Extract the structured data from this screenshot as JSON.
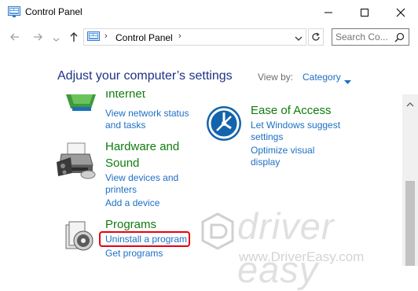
{
  "window": {
    "title": "Control Panel",
    "icon": "control-panel-icon",
    "controls": [
      "minimize",
      "maximize",
      "close"
    ]
  },
  "navigation": {
    "back_icon": "back-arrow-icon",
    "forward_icon": "forward-arrow-icon",
    "recent_icon": "chevron-down-icon",
    "up_icon": "up-arrow-icon",
    "breadcrumb": "Control Panel",
    "refresh_icon": "refresh-icon",
    "search_placeholder": "Search Co..."
  },
  "main": {
    "heading": "Adjust your computer’s settings",
    "view_by_label": "View by:",
    "view_by_value": "Category"
  },
  "categories": {
    "internet": {
      "title": "Internet",
      "links": [
        "View network status",
        "and tasks"
      ]
    },
    "hardware": {
      "title_line1": "Hardware and",
      "title_line2": "Sound",
      "links": [
        "View devices and",
        "printers",
        "Add a device"
      ]
    },
    "programs": {
      "title": "Programs",
      "links": [
        "Uninstall a program",
        "Get programs"
      ]
    },
    "ease": {
      "title": "Ease of Access",
      "links": [
        "Let Windows suggest",
        "settings",
        "Optimize visual",
        "display"
      ]
    }
  },
  "watermark": {
    "brand": "driver easy",
    "url": "www.DriverEasy.com"
  },
  "colors": {
    "heading": "#1e3287",
    "category_title": "#107c10",
    "link": "#1e6fc4",
    "highlight": "#e8000d"
  }
}
